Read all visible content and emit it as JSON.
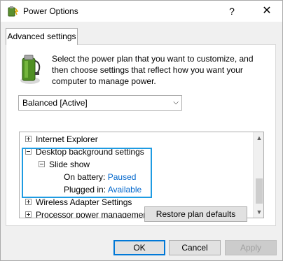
{
  "window": {
    "title": "Power Options",
    "help_label": "?",
    "close_label": "✕"
  },
  "tab": {
    "label": "Advanced settings"
  },
  "intro_text": "Select the power plan that you want to customize, and then choose settings that reflect how you want your computer to manage power.",
  "plan_select": {
    "value": "Balanced [Active]"
  },
  "tree": {
    "items": [
      {
        "label": "Internet Explorer"
      },
      {
        "label": "Desktop background settings"
      },
      {
        "label": "Slide show"
      },
      {
        "label": "On battery:",
        "value": "Paused"
      },
      {
        "label": "Plugged in:",
        "value": "Available"
      },
      {
        "label": "Wireless Adapter Settings"
      },
      {
        "label": "Processor power management"
      }
    ]
  },
  "buttons": {
    "restore": "Restore plan defaults",
    "ok": "OK",
    "cancel": "Cancel",
    "apply": "Apply"
  },
  "colors": {
    "highlight": "#1e9be2",
    "value_text": "#0066cc",
    "ok_border": "#0078d7"
  }
}
